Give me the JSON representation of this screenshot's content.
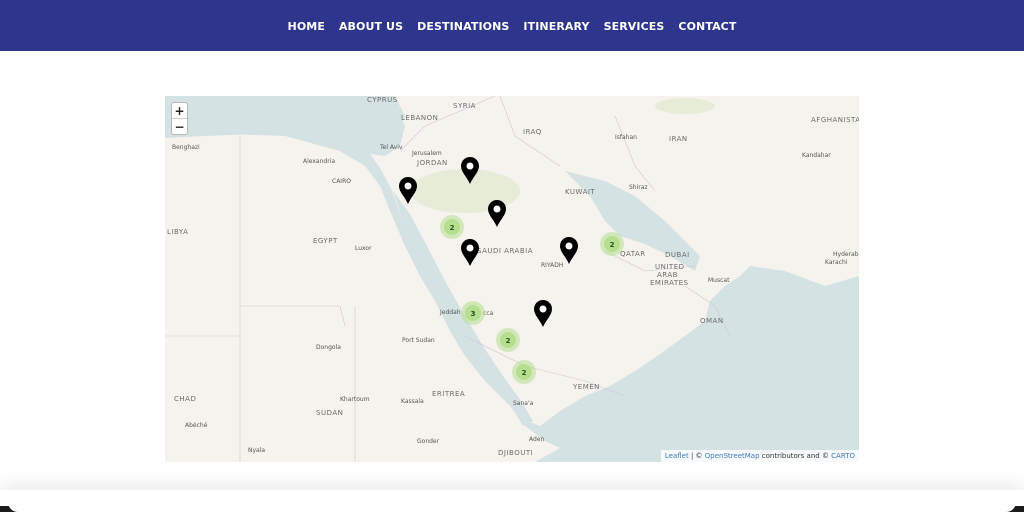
{
  "nav": {
    "items": [
      {
        "label": "HOME"
      },
      {
        "label": "ABOUT US"
      },
      {
        "label": "DESTINATIONS"
      },
      {
        "label": "ITINERARY"
      },
      {
        "label": "SERVICES"
      },
      {
        "label": "CONTACT"
      }
    ]
  },
  "map": {
    "zoom_in": "+",
    "zoom_out": "−",
    "attribution": {
      "leaflet": "Leaflet",
      "sep1": " | © ",
      "osm": "OpenStreetMap",
      "mid": " contributors and © ",
      "carto": "CARTO"
    },
    "labels": {
      "cyprus": "CYPRUS",
      "syria": "SYRIA",
      "lebanon": "LEBANON",
      "iraq": "IRAQ",
      "iran": "IRAN",
      "afghanistan": "AFGHANISTA",
      "benghazi": "Benghazi",
      "alexandria": "Alexandria",
      "tel_aviv": "Tel Aviv",
      "jerusalem": "Jerusalem",
      "jordan": "JORDAN",
      "cairo": "CAIRO",
      "kuwait": "KUWAIT",
      "isfahan": "Isfahan",
      "kandahar": "Kandahar",
      "shiraz": "Shiraz",
      "libya": "LIBYA",
      "egypt": "EGYPT",
      "saudi": "SAUDI ARABIA",
      "luxor": "Luxor",
      "riyadh": "RIYADH",
      "qatar": "QATAR",
      "dubai": "DUBAI",
      "uae1": "UNITED",
      "uae2": "ARAB",
      "uae3": "EMIRATES",
      "hyderabad": "Hyderab",
      "karachi": "Karachi",
      "muscat": "Muscat",
      "oman": "OMAN",
      "jeddah": "Jeddah",
      "mecca": "cca",
      "port_sudan": "Port Sudan",
      "dongola": "Dongola",
      "yemen": "YEMEN",
      "eritrea": "ERITREA",
      "khartoum": "Khartoum",
      "kassala": "Kassala",
      "sanaa": "Sana'a",
      "chad": "CHAD",
      "sudan": "SUDAN",
      "abeche": "Abéché",
      "aden": "Aden",
      "gonder": "Gonder",
      "nyala": "Nyala",
      "djibouti": "DJIBOUTI"
    },
    "clusters": [
      {
        "count": "2"
      },
      {
        "count": "2"
      },
      {
        "count": "3"
      },
      {
        "count": "2"
      },
      {
        "count": "2"
      }
    ],
    "pins_count": 6,
    "colors": {
      "water": "#d4e2e3",
      "land": "#f6f3ee",
      "cluster": "#b5de8f",
      "pin": "#000000"
    }
  }
}
